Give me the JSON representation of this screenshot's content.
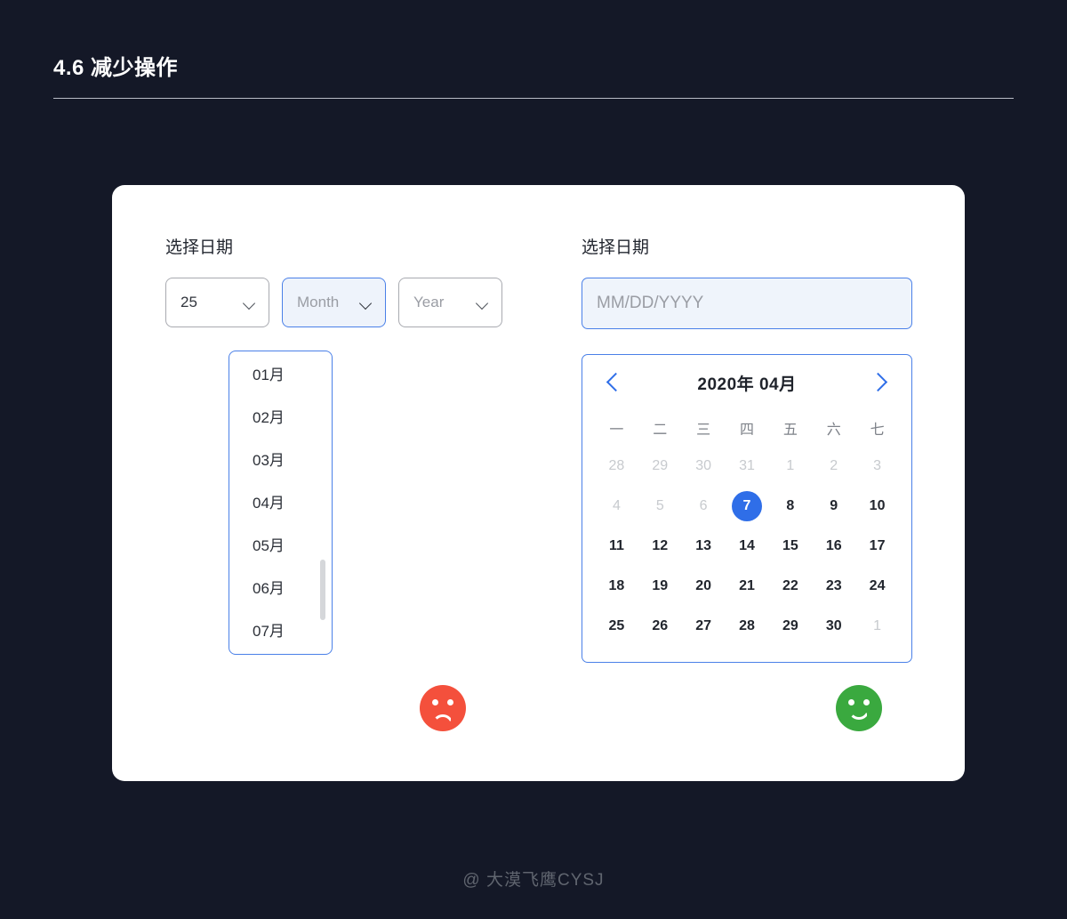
{
  "header": {
    "title": "4.6 减少操作"
  },
  "left_panel": {
    "label": "选择日期",
    "selects": [
      {
        "name": "day",
        "value": "25",
        "is_placeholder": false,
        "active": false
      },
      {
        "name": "month",
        "value": "Month",
        "is_placeholder": true,
        "active": true
      },
      {
        "name": "year",
        "value": "Year",
        "is_placeholder": true,
        "active": false
      }
    ],
    "dropdown": {
      "options": [
        "01月",
        "02月",
        "03月",
        "04月",
        "05月",
        "06月",
        "07月"
      ]
    },
    "verdict": "bad"
  },
  "right_panel": {
    "label": "选择日期",
    "date_input": {
      "value": "",
      "placeholder": "MM/DD/YYYY"
    },
    "calendar": {
      "prev_icon": "chevron-left-icon",
      "next_icon": "chevron-right-icon",
      "title": "2020年 04月",
      "weekdays": [
        "一",
        "二",
        "三",
        "四",
        "五",
        "六",
        "七"
      ],
      "weeks": [
        [
          {
            "d": "28",
            "muted": true,
            "selected": false
          },
          {
            "d": "29",
            "muted": true,
            "selected": false
          },
          {
            "d": "30",
            "muted": true,
            "selected": false
          },
          {
            "d": "31",
            "muted": true,
            "selected": false
          },
          {
            "d": "1",
            "muted": true,
            "selected": false
          },
          {
            "d": "2",
            "muted": true,
            "selected": false
          },
          {
            "d": "3",
            "muted": true,
            "selected": false
          }
        ],
        [
          {
            "d": "4",
            "muted": true,
            "selected": false
          },
          {
            "d": "5",
            "muted": true,
            "selected": false
          },
          {
            "d": "6",
            "muted": true,
            "selected": false
          },
          {
            "d": "7",
            "muted": false,
            "selected": true
          },
          {
            "d": "8",
            "muted": false,
            "selected": false
          },
          {
            "d": "9",
            "muted": false,
            "selected": false
          },
          {
            "d": "10",
            "muted": false,
            "selected": false
          }
        ],
        [
          {
            "d": "11",
            "muted": false,
            "selected": false
          },
          {
            "d": "12",
            "muted": false,
            "selected": false
          },
          {
            "d": "13",
            "muted": false,
            "selected": false
          },
          {
            "d": "14",
            "muted": false,
            "selected": false
          },
          {
            "d": "15",
            "muted": false,
            "selected": false
          },
          {
            "d": "16",
            "muted": false,
            "selected": false
          },
          {
            "d": "17",
            "muted": false,
            "selected": false
          }
        ],
        [
          {
            "d": "18",
            "muted": false,
            "selected": false
          },
          {
            "d": "19",
            "muted": false,
            "selected": false
          },
          {
            "d": "20",
            "muted": false,
            "selected": false
          },
          {
            "d": "21",
            "muted": false,
            "selected": false
          },
          {
            "d": "22",
            "muted": false,
            "selected": false
          },
          {
            "d": "23",
            "muted": false,
            "selected": false
          },
          {
            "d": "24",
            "muted": false,
            "selected": false
          }
        ],
        [
          {
            "d": "25",
            "muted": false,
            "selected": false
          },
          {
            "d": "26",
            "muted": false,
            "selected": false
          },
          {
            "d": "27",
            "muted": false,
            "selected": false
          },
          {
            "d": "28",
            "muted": false,
            "selected": false
          },
          {
            "d": "29",
            "muted": false,
            "selected": false
          },
          {
            "d": "30",
            "muted": false,
            "selected": false
          },
          {
            "d": "1",
            "muted": true,
            "selected": false
          }
        ]
      ]
    },
    "verdict": "good"
  },
  "footer": {
    "watermark": "@ 大漠飞鹰CYSJ"
  },
  "colors": {
    "background": "#141827",
    "card": "#ffffff",
    "accent_blue": "#2f6ee8",
    "active_border": "#4a80e8",
    "active_fill": "#eef3fb",
    "bad_red": "#f4503c",
    "good_green": "#3aa93f",
    "muted_text": "#c7cace"
  }
}
